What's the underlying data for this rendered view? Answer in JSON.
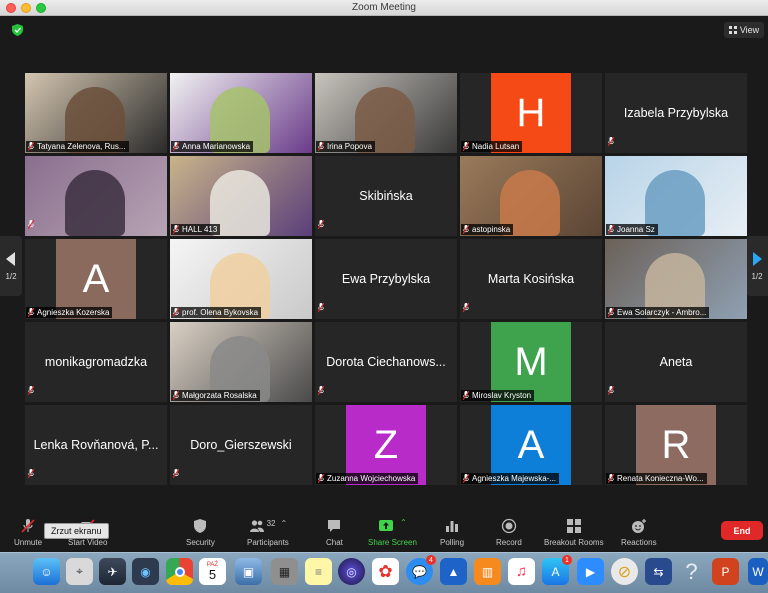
{
  "window": {
    "title": "Zoom Meeting"
  },
  "view_button": {
    "label": "View"
  },
  "pagination": {
    "left": "1/2",
    "right": "1/2"
  },
  "participants": [
    {
      "name": "Tatyana Zelenova, Rus...",
      "kind": "video"
    },
    {
      "name": "Anna Marianowska",
      "kind": "video"
    },
    {
      "name": "Irina Popova",
      "kind": "video"
    },
    {
      "name": "Nadia Lutsan",
      "kind": "letter",
      "letter": "H",
      "color": "#f54a16"
    },
    {
      "name": "Izabela Przybylska",
      "kind": "name"
    },
    {
      "name": "",
      "kind": "video"
    },
    {
      "name": "HALL 413",
      "kind": "video",
      "active": true
    },
    {
      "name": "Skibińska",
      "kind": "name"
    },
    {
      "name": "astopinska",
      "kind": "video"
    },
    {
      "name": "Joanna Sz",
      "kind": "video"
    },
    {
      "name": "Agnieszka Kozerska",
      "kind": "letter",
      "letter": "A",
      "color": "#8b6a5e"
    },
    {
      "name": "prof. Olena Bykovska",
      "kind": "video"
    },
    {
      "name": "Ewa Przybylska",
      "kind": "name"
    },
    {
      "name": "Marta Kosińska",
      "kind": "name"
    },
    {
      "name": "Ewa Solarczyk - Ambro...",
      "kind": "video"
    },
    {
      "name": "monikagromadzka",
      "kind": "name"
    },
    {
      "name": "Małgorzata Rosalska",
      "kind": "video"
    },
    {
      "name": "Dorota Ciechanows...",
      "kind": "name"
    },
    {
      "name": "Miroslav Kryston",
      "kind": "letter",
      "letter": "M",
      "color": "#3fa34d"
    },
    {
      "name": "Aneta",
      "kind": "name"
    },
    {
      "name": "Lenka Rovňanová, P...",
      "kind": "name"
    },
    {
      "name": "Doro_Gierszewski",
      "kind": "name"
    },
    {
      "name": "Zuzanna Wojciechowska",
      "kind": "letter",
      "letter": "Z",
      "color": "#b92bc8"
    },
    {
      "name": "Agnieszka Majewska-...",
      "kind": "letter",
      "letter": "A",
      "color": "#0e7fd8"
    },
    {
      "name": "Renata Konieczna-Wo...",
      "kind": "letter",
      "letter": "R",
      "color": "#8d6b60"
    }
  ],
  "toolbar": {
    "unmute": "Unmute",
    "start_video": "Start Video",
    "security": "Security",
    "participants": "Participants",
    "participants_count": "32",
    "chat": "Chat",
    "share_screen": "Share Screen",
    "polling": "Polling",
    "record": "Record",
    "breakout_rooms": "Breakout Rooms",
    "reactions": "Reactions",
    "end": "End"
  },
  "tooltip": "Zrzut ekranu",
  "dock": {
    "calendar_month": "PAŹ",
    "calendar_day": "5",
    "messages_badge": "4",
    "appstore_badge": "1"
  },
  "colors": {
    "share_green": "#3fd54b",
    "end_red": "#e02828",
    "active_outline": "#e8e46a"
  }
}
